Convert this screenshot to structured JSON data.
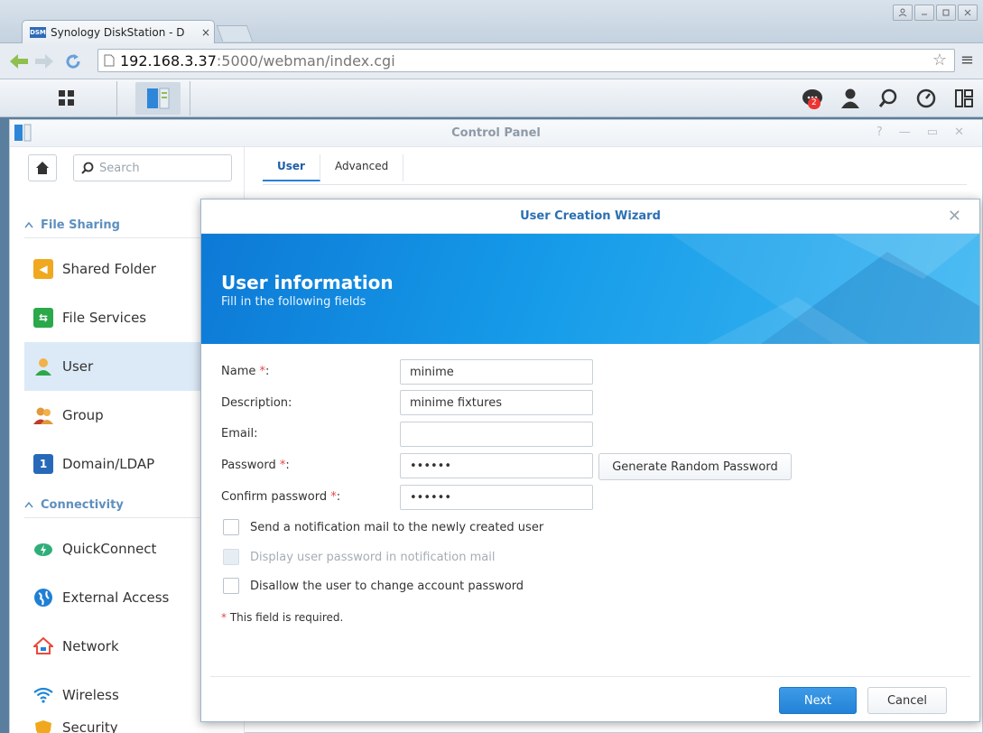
{
  "browser": {
    "tab_title": "Synology DiskStation - D",
    "tab_favicon": "DSM",
    "tab_close": "×",
    "url_host": "192.168.3.37",
    "url_path": ":5000/webman/index.cgi"
  },
  "window": {
    "title": "Control Panel"
  },
  "sidebar": {
    "search_placeholder": "Search",
    "sections": [
      {
        "label": "File Sharing"
      },
      {
        "label": "Connectivity"
      }
    ],
    "items": [
      {
        "label": "Shared Folder",
        "icon": "shared-folder-icon",
        "color": "#f0a81e"
      },
      {
        "label": "File Services",
        "icon": "file-services-icon",
        "color": "#2aa84a"
      },
      {
        "label": "User",
        "icon": "user-icon",
        "color": "#f2b14a",
        "active": true
      },
      {
        "label": "Group",
        "icon": "group-icon",
        "color": "#e2983b"
      },
      {
        "label": "Domain/LDAP",
        "icon": "domain-ldap-icon",
        "color": "#2769b8"
      },
      {
        "label": "QuickConnect",
        "icon": "quickconnect-icon",
        "color": "#2fae7a"
      },
      {
        "label": "External Access",
        "icon": "globe-icon",
        "color": "#1f7fd4"
      },
      {
        "label": "Network",
        "icon": "network-icon",
        "color": "#e84b3c"
      },
      {
        "label": "Wireless",
        "icon": "wifi-icon",
        "color": "#1d86d8"
      },
      {
        "label": "Security",
        "icon": "shield-icon",
        "color": "#f0a81e"
      }
    ]
  },
  "main_tabs": [
    {
      "label": "User",
      "active": true
    },
    {
      "label": "Advanced",
      "active": false
    }
  ],
  "taskbar": {
    "notification_count": "2"
  },
  "wizard": {
    "title": "User Creation Wizard",
    "heading": "User information",
    "subheading": "Fill in the following fields",
    "fields": {
      "name_label": "Name ",
      "name_value": "minime",
      "description_label": "Description:",
      "description_value": "minime fixtures",
      "email_label": "Email:",
      "email_value": "",
      "password_label": "Password ",
      "password_value": "••••••",
      "confirm_label": "Confirm password ",
      "confirm_value": "••••••",
      "required_mark": "*",
      "colon": ":"
    },
    "generate_label": "Generate Random Password",
    "checkboxes": [
      {
        "label": "Send a notification mail to the newly created user",
        "disabled": false
      },
      {
        "label": "Display user password in notification mail",
        "disabled": true
      },
      {
        "label": "Disallow the user to change account password",
        "disabled": false
      }
    ],
    "note_mark": "*",
    "note_text": " This field is required.",
    "next_label": "Next",
    "cancel_label": "Cancel"
  }
}
